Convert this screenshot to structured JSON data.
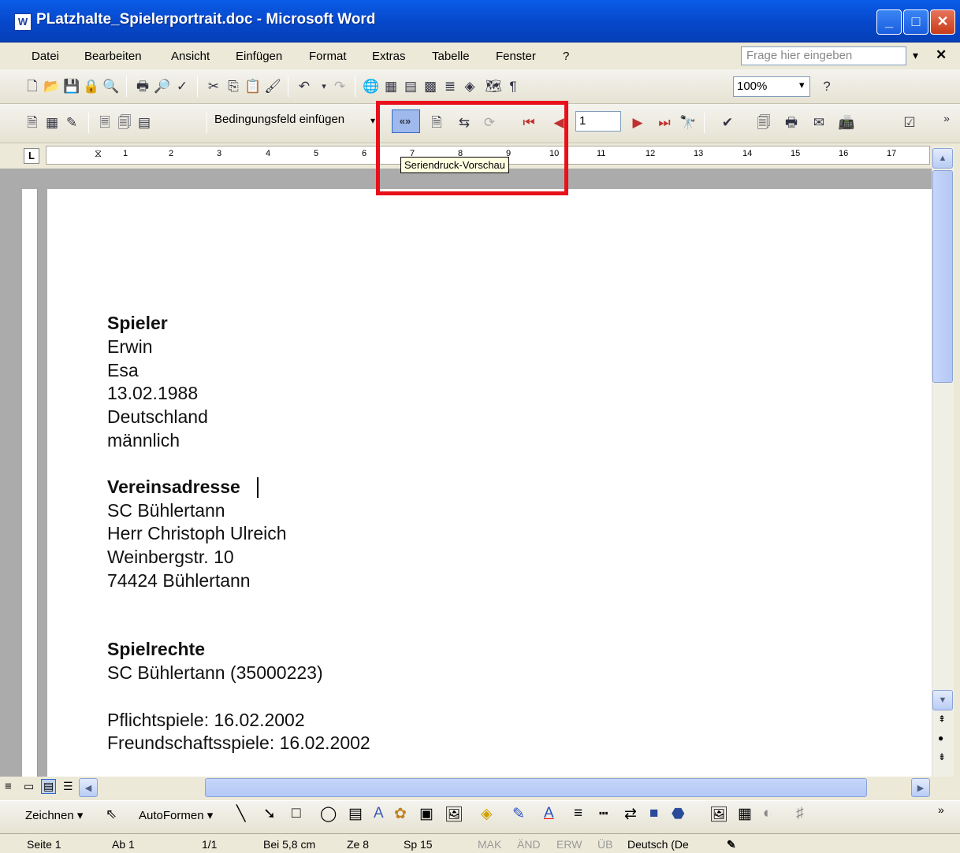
{
  "window": {
    "title": "PLatzhalte_Spielerportrait.doc - Microsoft Word",
    "app_icon": "W",
    "minimize": "_",
    "maximize": "□",
    "close": "✕"
  },
  "menu": [
    "Datei",
    "Bearbeiten",
    "Ansicht",
    "Einfügen",
    "Format",
    "Extras",
    "Tabelle",
    "Fenster",
    "?"
  ],
  "ask_placeholder": "Frage hier eingeben",
  "zoom": "100%",
  "mailmerge": {
    "insert_field": "Bedingungsfeld einfügen",
    "record": "1",
    "tooltip": "Seriendruck-Vorschau"
  },
  "ruler": [
    "1",
    "2",
    "3",
    "4",
    "5",
    "6",
    "7",
    "8",
    "9",
    "10",
    "11",
    "12",
    "13",
    "14",
    "15",
    "16",
    "17"
  ],
  "document": {
    "spieler_heading": "Spieler",
    "spieler": [
      "Erwin",
      "Esa",
      "13.02.1988",
      "Deutschland",
      "männlich"
    ],
    "verein_heading": "Vereinsadresse",
    "verein": [
      "SC Bühlertann",
      "Herr Christoph Ulreich",
      "Weinbergstr. 10",
      "74424 Bühlertann"
    ],
    "rechte_heading": "Spielrechte",
    "rechte": [
      "SC Bühlertann (35000223)"
    ],
    "spiele": [
      "Pflichtspiele: 16.02.2002",
      "Freundschaftsspiele: 16.02.2002"
    ]
  },
  "drawing": {
    "zeichnen": "Zeichnen ▾",
    "autoformen": "AutoFormen ▾"
  },
  "status": {
    "seite": "Seite 1",
    "ab": "Ab 1",
    "pages": "1/1",
    "bei": "Bei 5,8 cm",
    "ze": "Ze 8",
    "sp": "Sp 15",
    "mak": "MAK",
    "aend": "ÄND",
    "erw": "ERW",
    "ueb": "ÜB",
    "lang": "Deutsch (De"
  }
}
